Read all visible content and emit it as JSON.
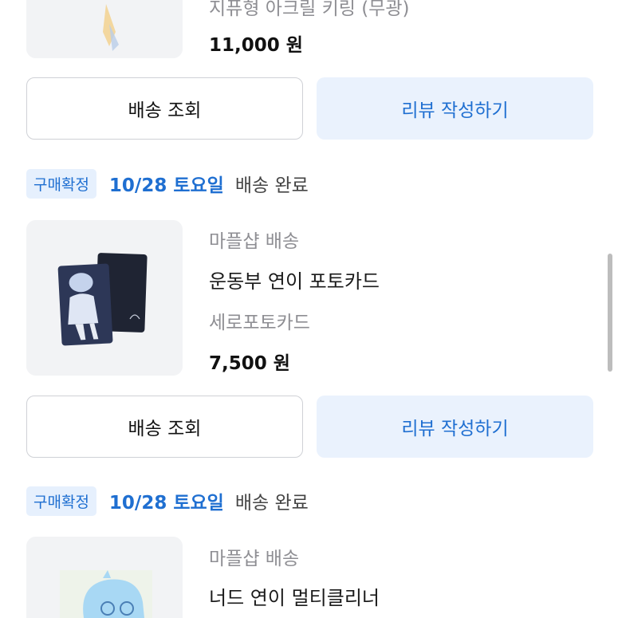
{
  "orders": [
    {
      "option": "지퓨형 아크릴 키링 (무광)",
      "price": "11,000 원"
    },
    {
      "badge": "구매확정",
      "date": "10/28 토요일",
      "delivery_status": "배송 완료",
      "shipping_label": "마플샵 배송",
      "title": "운동부 연이 포토카드",
      "option": "세로포토카드",
      "price": "7,500 원"
    },
    {
      "badge": "구매확정",
      "date": "10/28 토요일",
      "delivery_status": "배송 완료",
      "shipping_label": "마플샵 배송",
      "title": "너드 연이 멀티클리너"
    }
  ],
  "buttons": {
    "track_label": "배송 조회",
    "review_label": "리뷰 작성하기"
  },
  "colors": {
    "accent": "#1f6fd1",
    "accent_bg": "#eaf2fd",
    "thumb_bg": "#f2f3f5"
  }
}
